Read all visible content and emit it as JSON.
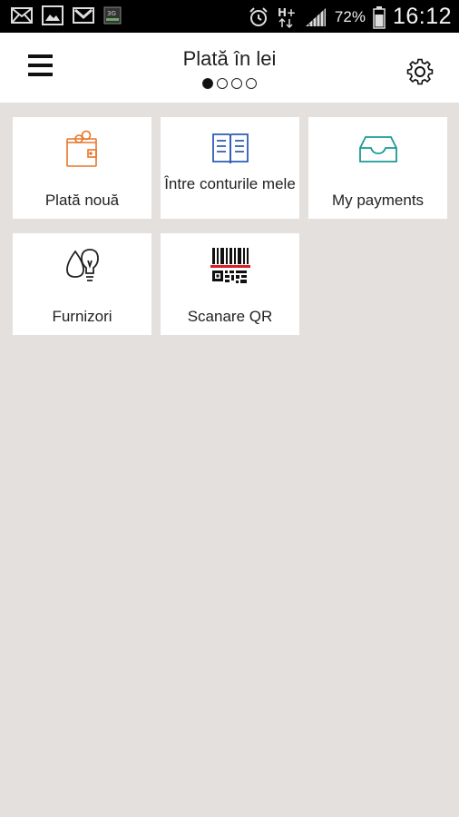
{
  "statusbar": {
    "battery_pct": "72%",
    "time": "16:12",
    "network": "H+",
    "notif_icons": [
      "mail-icon",
      "gallery-icon",
      "gmail-icon",
      "3g-app-icon"
    ]
  },
  "header": {
    "title": "Plată în lei",
    "pager": {
      "count": 4,
      "active_index": 0
    }
  },
  "tiles": [
    {
      "label": "Plată nouă",
      "icon": "wallet-icon",
      "color": "#e8742a"
    },
    {
      "label": "Între conturile mele",
      "icon": "book-icon",
      "color": "#2f5cb5"
    },
    {
      "label": "My payments",
      "icon": "inbox-tray-icon",
      "color": "#1a9b94"
    },
    {
      "label": "Furnizori",
      "icon": "drop-bulb-icon",
      "color": "#222222"
    },
    {
      "label": "Scanare QR",
      "icon": "barcode-qr-icon",
      "color": "#111111"
    }
  ],
  "colors": {
    "background": "#e4e0dd",
    "appbar": "#ffffff",
    "accent_red": "#d91f26"
  }
}
